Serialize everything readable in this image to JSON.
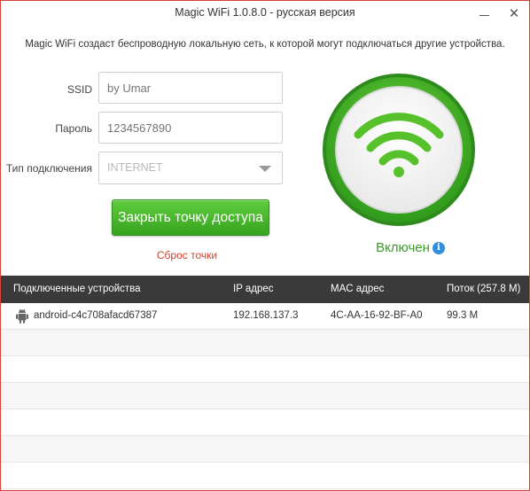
{
  "window": {
    "title": "Magic WiFi  1.0.8.0 - русская версия",
    "minimize_glyph": "—",
    "close_glyph": "✕"
  },
  "intro": "Magic WiFi создаст беспроводную локальную сеть, к которой могут подключаться другие устройства.",
  "form": {
    "ssid_label": "SSID",
    "ssid_placeholder": "by Umar",
    "password_label": "Пароль",
    "password_placeholder": "1234567890",
    "type_label": "Тип подключения",
    "type_value": "INTERNET",
    "main_button": "Закрыть точку доступа",
    "reset_link": "Сброс точки"
  },
  "status": {
    "text": "Включен",
    "info_glyph": "i",
    "icon": "wifi-icon",
    "colors": {
      "ring": "#3aa524",
      "accent": "#56c12b"
    }
  },
  "table": {
    "headers": [
      "Подключенные устройства",
      "IP адрес",
      "MAC адрес",
      "Поток (257.8 M)"
    ],
    "rows": [
      {
        "icon": "android-icon",
        "device": "android-c4c708afacd67387",
        "ip": "192.168.137.3",
        "mac": "4C-AA-16-92-BF-A0",
        "traffic": "99.3 M"
      }
    ]
  }
}
